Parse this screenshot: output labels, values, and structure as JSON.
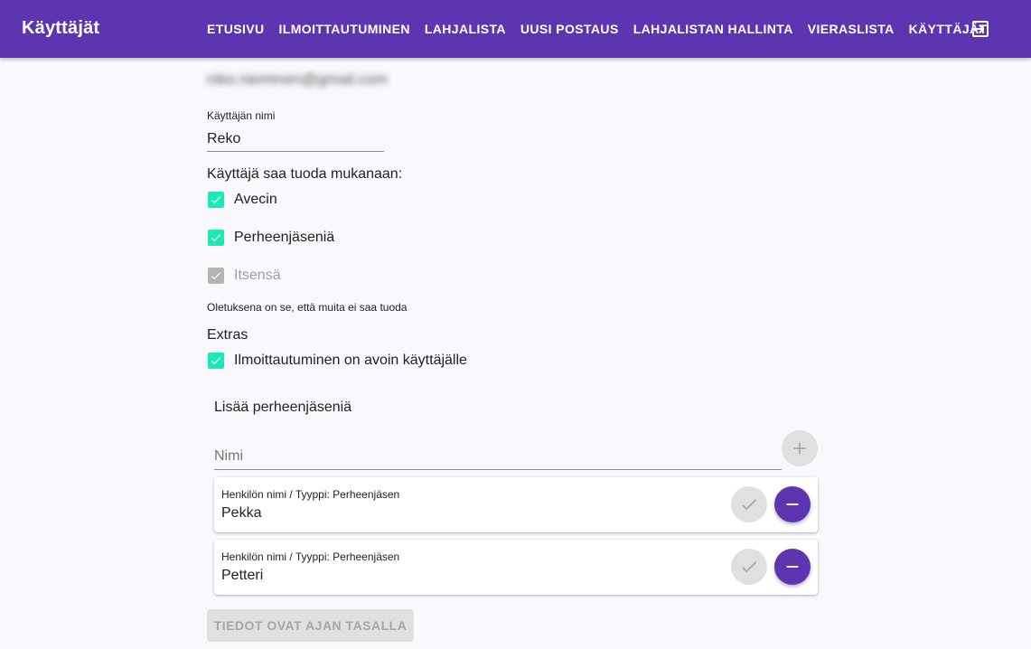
{
  "app": {
    "title": "Käyttäjät"
  },
  "nav": {
    "items": [
      {
        "label": "ETUSIVU"
      },
      {
        "label": "ILMOITTAUTUMINEN"
      },
      {
        "label": "LAHJALISTA"
      },
      {
        "label": "UUSI POSTAUS"
      },
      {
        "label": "LAHJALISTAN HALLINTA"
      },
      {
        "label": "VIERASLISTA"
      },
      {
        "label": "KÄYTTÄJÄT"
      }
    ],
    "logout_icon": "logout-icon"
  },
  "user": {
    "email": "niko.nieminen@gmail.com",
    "name_label": "Käyttäjän nimi",
    "name_value": "Reko"
  },
  "bring": {
    "heading": "Käyttäjä saa tuoda mukanaan:",
    "options": [
      {
        "label": "Avecin",
        "checked": true,
        "disabled": false
      },
      {
        "label": "Perheenjäseniä",
        "checked": true,
        "disabled": false
      },
      {
        "label": "Itsensä",
        "checked": true,
        "disabled": true
      }
    ],
    "note": "Oletuksena on se, että muita ei saa tuoda"
  },
  "extras": {
    "heading": "Extras",
    "options": [
      {
        "label": "Ilmoittautuminen on avoin käyttäjälle",
        "checked": true
      }
    ]
  },
  "family": {
    "heading": "Lisää perheenjäseniä",
    "new_placeholder": "Nimi",
    "members": [
      {
        "label": "Henkilön nimi / Tyyppi: Perheenjäsen",
        "name": "Pekka"
      },
      {
        "label": "Henkilön nimi / Tyyppi: Perheenjäsen",
        "name": "Petteri"
      }
    ]
  },
  "actions": {
    "save_label": "TIEDOT OVAT AJAN TASALLA"
  },
  "colors": {
    "primary": "#5e35b1",
    "accent": "#1de9b6",
    "disabled": "#e0e0e0",
    "background": "#f9f8fd"
  }
}
